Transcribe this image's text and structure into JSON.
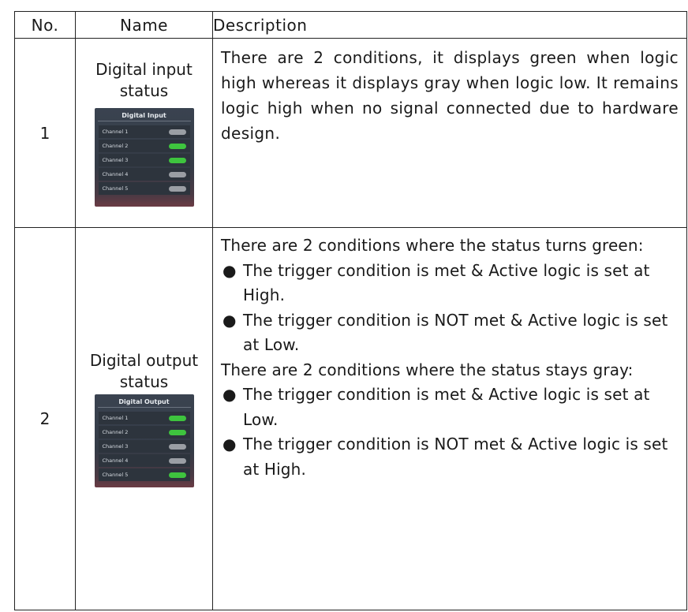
{
  "headers": {
    "no": "No.",
    "name": "Name",
    "description": "Description"
  },
  "rows": [
    {
      "no": "1",
      "name": "Digital input status",
      "description": "There are 2 conditions, it displays green when logic high whereas it displays gray when logic low. It remains logic high when no signal connected due to hardware design.",
      "panel": {
        "title": "Digital Input",
        "channels": [
          {
            "label": "Channel 1",
            "state": "gray"
          },
          {
            "label": "Channel 2",
            "state": "green"
          },
          {
            "label": "Channel 3",
            "state": "green"
          },
          {
            "label": "Channel 4",
            "state": "gray"
          },
          {
            "label": "Channel 5",
            "state": "gray"
          }
        ]
      }
    },
    {
      "no": "2",
      "name": "Digital output status",
      "description": {
        "green_intro": "There are 2 conditions where the status turns green:",
        "green_bullets": [
          "The trigger condition is met & Active logic is set at High.",
          "The trigger condition is NOT met & Active logic is set at Low."
        ],
        "gray_intro": "There are 2 conditions where the status stays gray:",
        "gray_bullets": [
          "The trigger condition is met & Active logic is set at Low.",
          "The trigger condition is NOT met & Active logic is set at High."
        ]
      },
      "panel": {
        "title": "Digital Output",
        "channels": [
          {
            "label": "Channel 1",
            "state": "green"
          },
          {
            "label": "Channel 2",
            "state": "green"
          },
          {
            "label": "Channel 3",
            "state": "gray"
          },
          {
            "label": "Channel 4",
            "state": "gray"
          },
          {
            "label": "Channel 5",
            "state": "green"
          }
        ]
      }
    }
  ],
  "colors": {
    "green": "#3ec43e",
    "gray": "#9a9ea4",
    "panel_bg": "#3a4350"
  }
}
